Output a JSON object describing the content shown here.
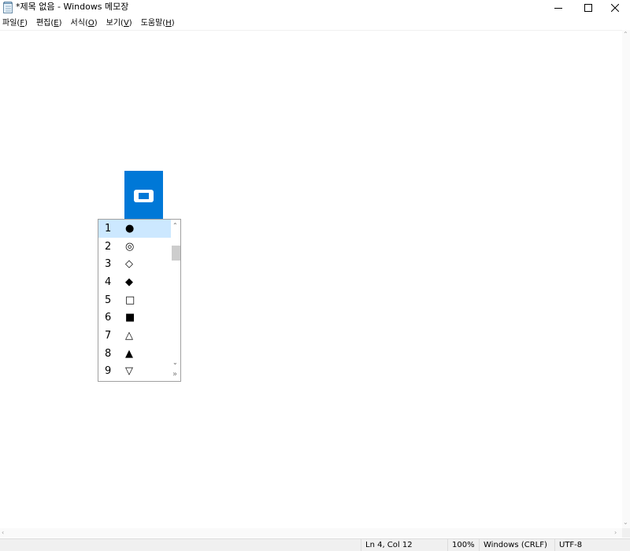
{
  "window": {
    "title": "*제목 없음 - Windows 메모장",
    "controls": {
      "minimize": "—",
      "maximize": "☐",
      "close": "✕"
    }
  },
  "menu": [
    {
      "label": "파일",
      "accel": "F"
    },
    {
      "label": "편집",
      "accel": "E"
    },
    {
      "label": "서식",
      "accel": "O"
    },
    {
      "label": "보기",
      "accel": "V"
    },
    {
      "label": "도움말",
      "accel": "H"
    }
  ],
  "candidates": {
    "selected_index": 0,
    "items": [
      {
        "num": "1",
        "symbol": "●"
      },
      {
        "num": "2",
        "symbol": "◎"
      },
      {
        "num": "3",
        "symbol": "◇"
      },
      {
        "num": "4",
        "symbol": "◆"
      },
      {
        "num": "5",
        "symbol": "□"
      },
      {
        "num": "6",
        "symbol": "■"
      },
      {
        "num": "7",
        "symbol": "△"
      },
      {
        "num": "8",
        "symbol": "▲"
      },
      {
        "num": "9",
        "symbol": "▽"
      }
    ],
    "expand_glyph": "»"
  },
  "status": {
    "position": "Ln 4, Col 12",
    "zoom": "100%",
    "line_ending": "Windows (CRLF)",
    "encoding": "UTF-8"
  },
  "colors": {
    "ime_accent": "#0078d7",
    "selected_row": "#cce8ff"
  }
}
